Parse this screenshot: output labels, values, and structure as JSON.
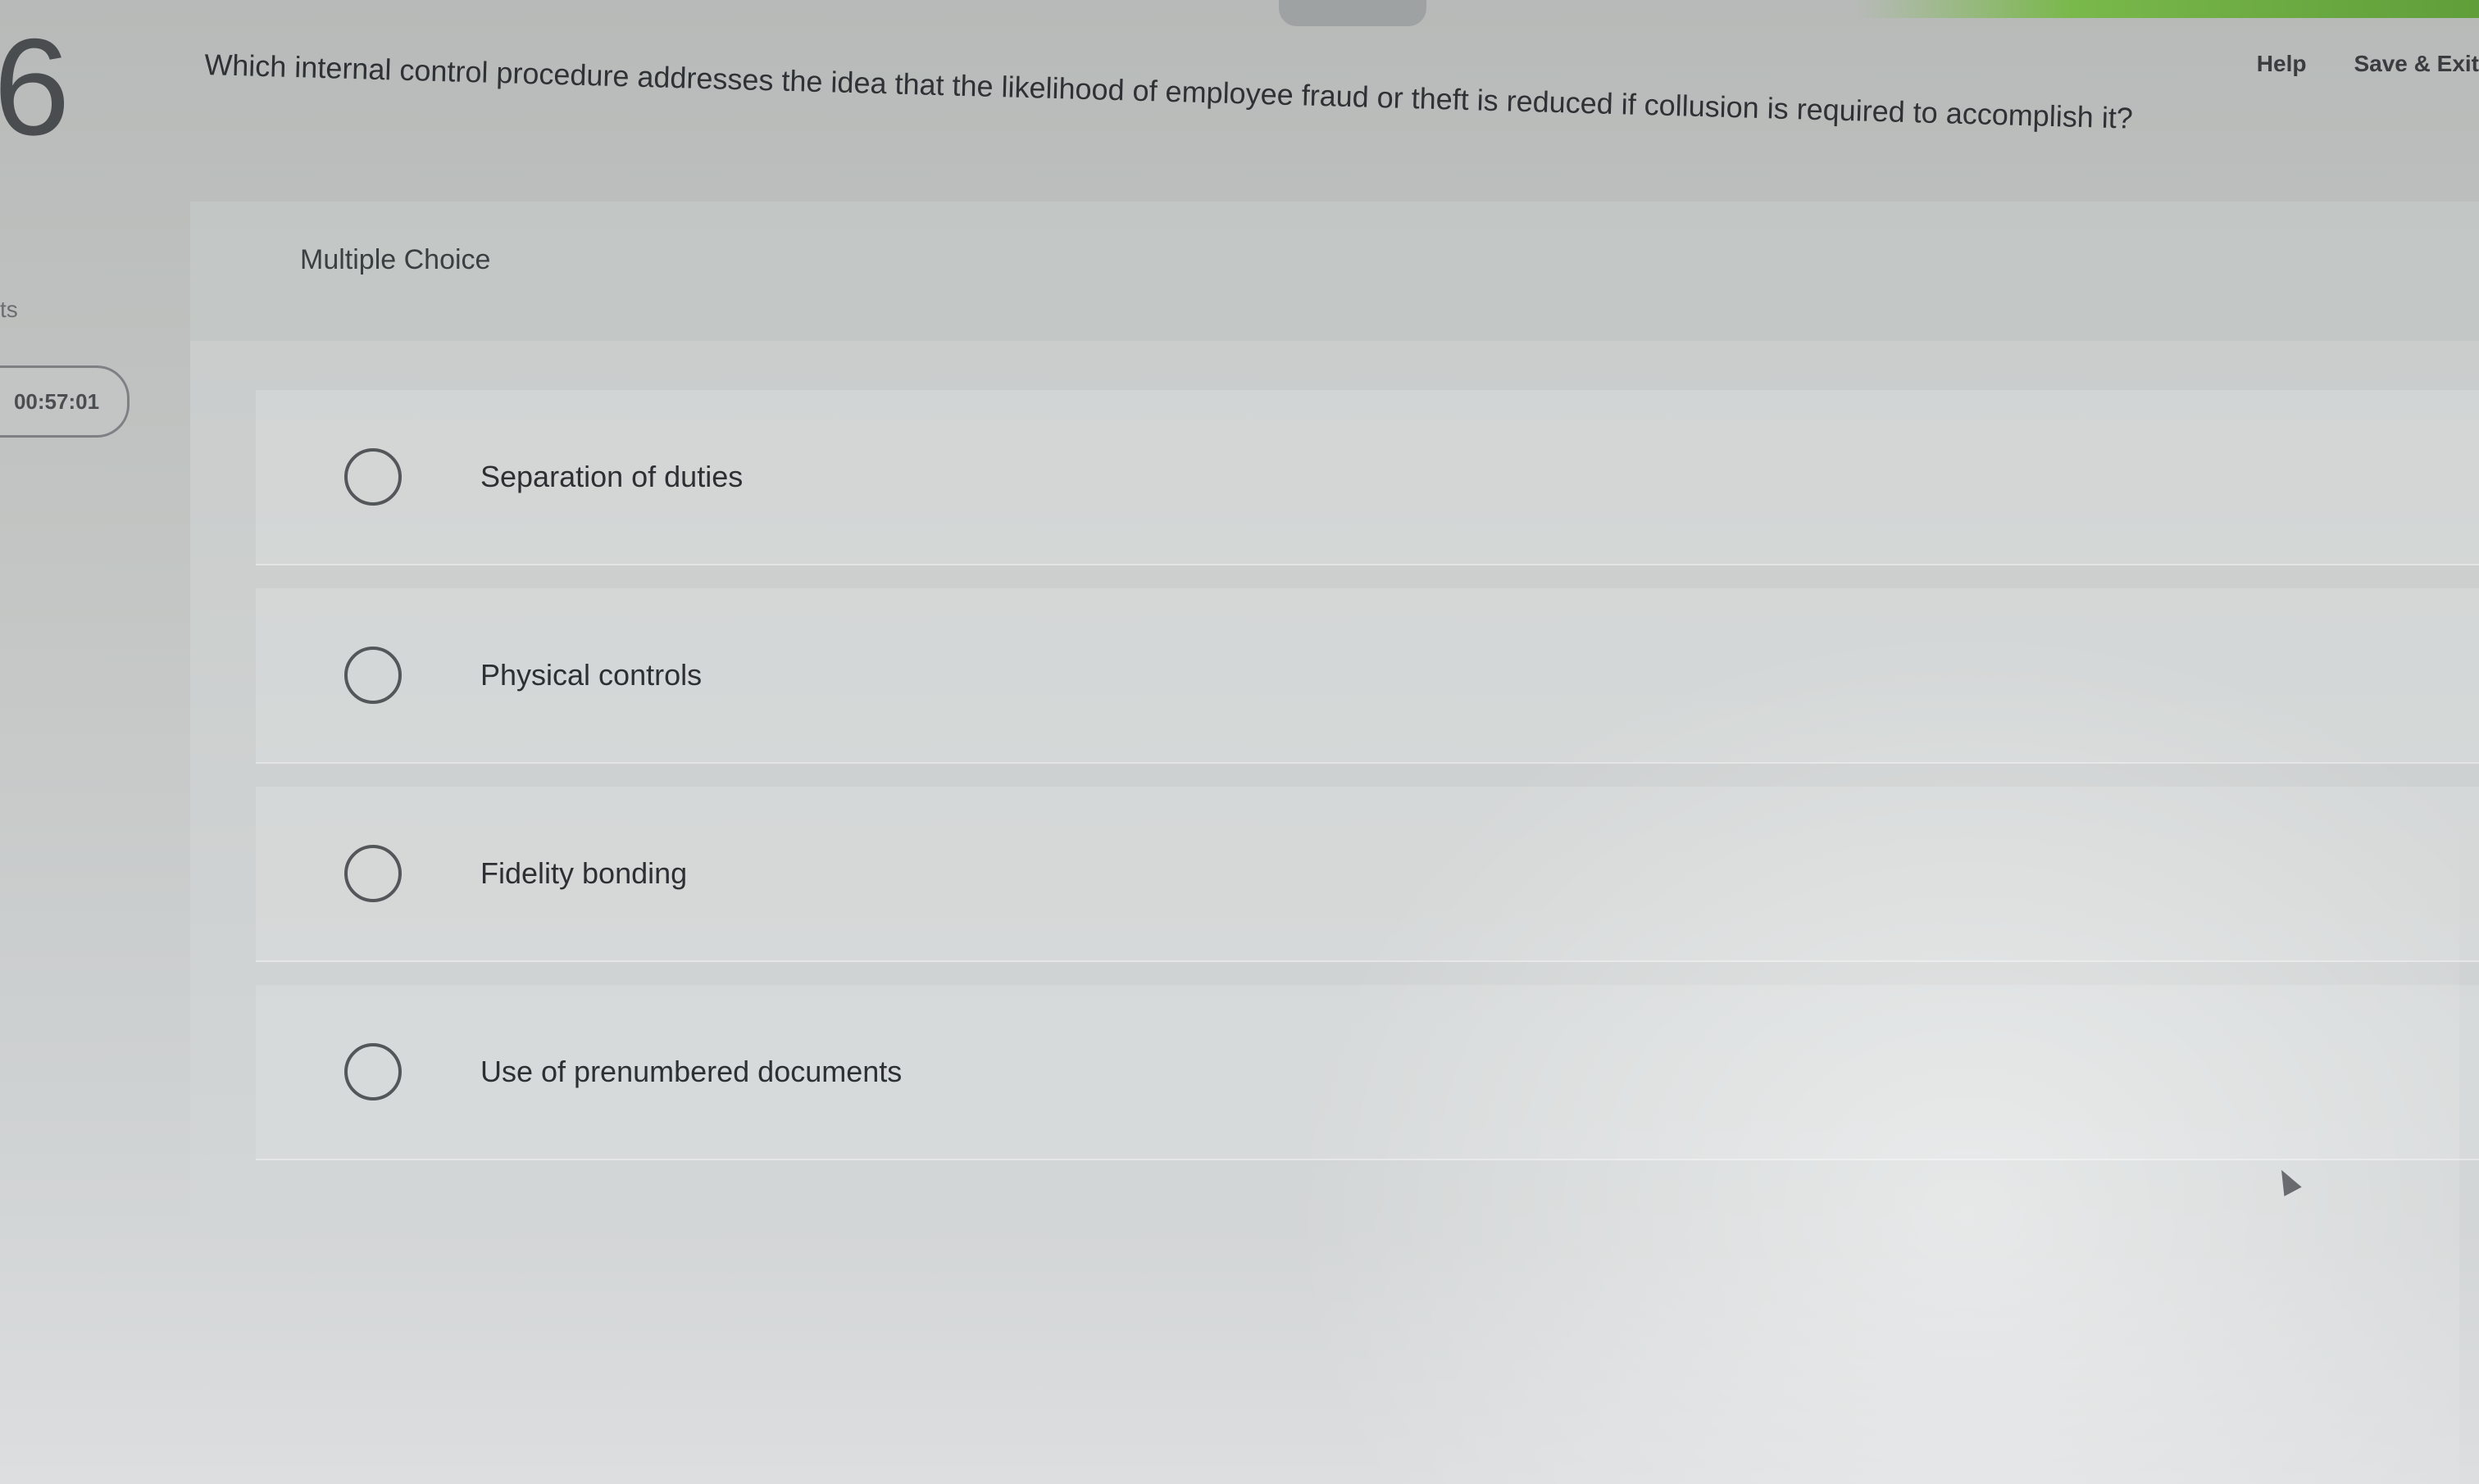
{
  "header": {
    "help_label": "Help",
    "save_exit_label": "Save & Exit"
  },
  "question": {
    "number": "6",
    "text": "Which internal control procedure addresses the idea that the likelihood of employee fraud or theft is reduced if collusion is required to accomplish it?",
    "type_label": "Multiple Choice"
  },
  "sidebar": {
    "fragment": "ts",
    "timer": "00:57:01"
  },
  "options": [
    {
      "label": "Separation of duties"
    },
    {
      "label": "Physical controls"
    },
    {
      "label": "Fidelity bonding"
    },
    {
      "label": "Use of prenumbered documents"
    }
  ],
  "colors": {
    "accent_green": "#79b84a",
    "page_gray": "#c3c6c4",
    "text_dark": "#2f3336"
  }
}
